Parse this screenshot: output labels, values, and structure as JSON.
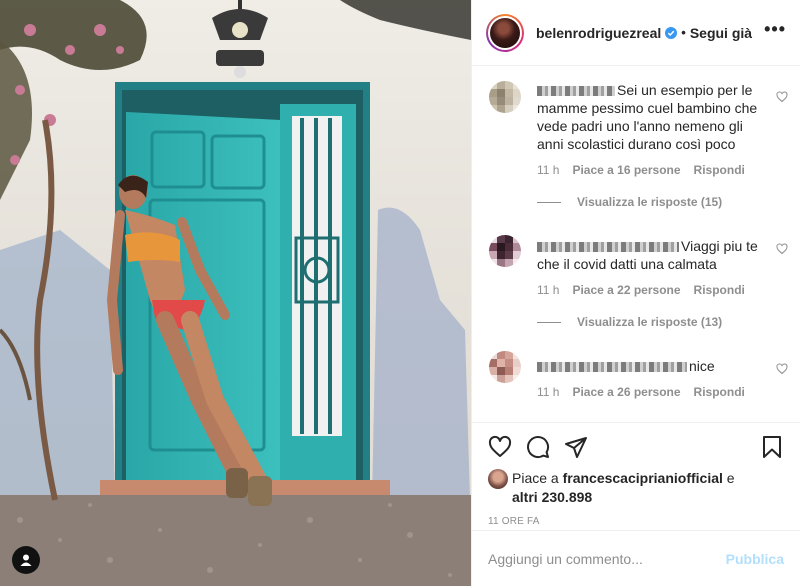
{
  "post": {
    "username": "belenrodriguezreal",
    "follow_label": "Segui già",
    "more_label": "•••",
    "verified_icon": "verified-badge-icon",
    "accent_color": "#0095f6"
  },
  "comments": [
    {
      "text": "Sei un esempio per le mamme pessimo cuel bambino che vede padri uno l'anno nemeno gli anni scolastici durano così poco",
      "time": "11 h",
      "likes_label": "Piace a 16 persone",
      "reply_label": "Rispondi",
      "view_replies": "Visualizza le risposte (15)"
    },
    {
      "text": "Viaggi piu te che il covid datti una calmata",
      "time": "11 h",
      "likes_label": "Piace a 22 persone",
      "reply_label": "Rispondi",
      "view_replies": "Visualizza le risposte (13)"
    },
    {
      "text": "nice",
      "time": "11 h",
      "likes_label": "Piace a 26 persone",
      "reply_label": "Rispondi"
    }
  ],
  "likes": {
    "prefix": "Piace a",
    "user": "francescaciprianiofficial",
    "connector": "e",
    "others": "altri 230.898"
  },
  "timestamp": "11 ORE FA",
  "add_comment": {
    "placeholder": "Aggiungi un commento...",
    "publish_label": "Pubblica",
    "publish_color": "#b2dffc"
  }
}
